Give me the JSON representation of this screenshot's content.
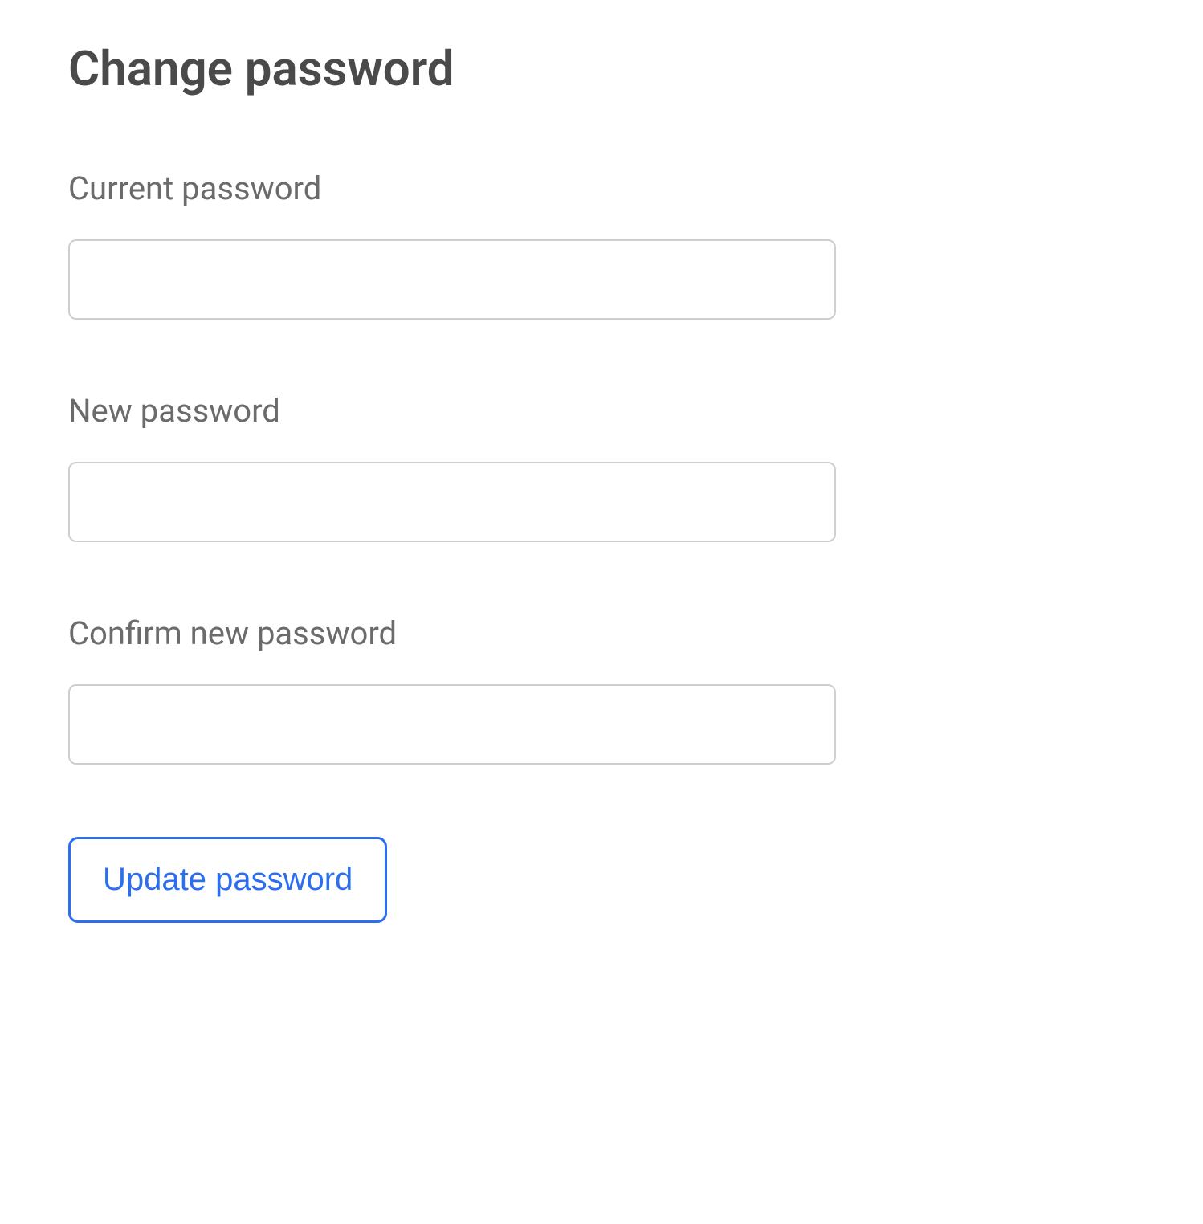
{
  "page": {
    "title": "Change password"
  },
  "fields": {
    "current_password": {
      "label": "Current password",
      "value": ""
    },
    "new_password": {
      "label": "New password",
      "value": ""
    },
    "confirm_password": {
      "label": "Confirm new password",
      "value": ""
    }
  },
  "actions": {
    "submit_label": "Update password"
  }
}
